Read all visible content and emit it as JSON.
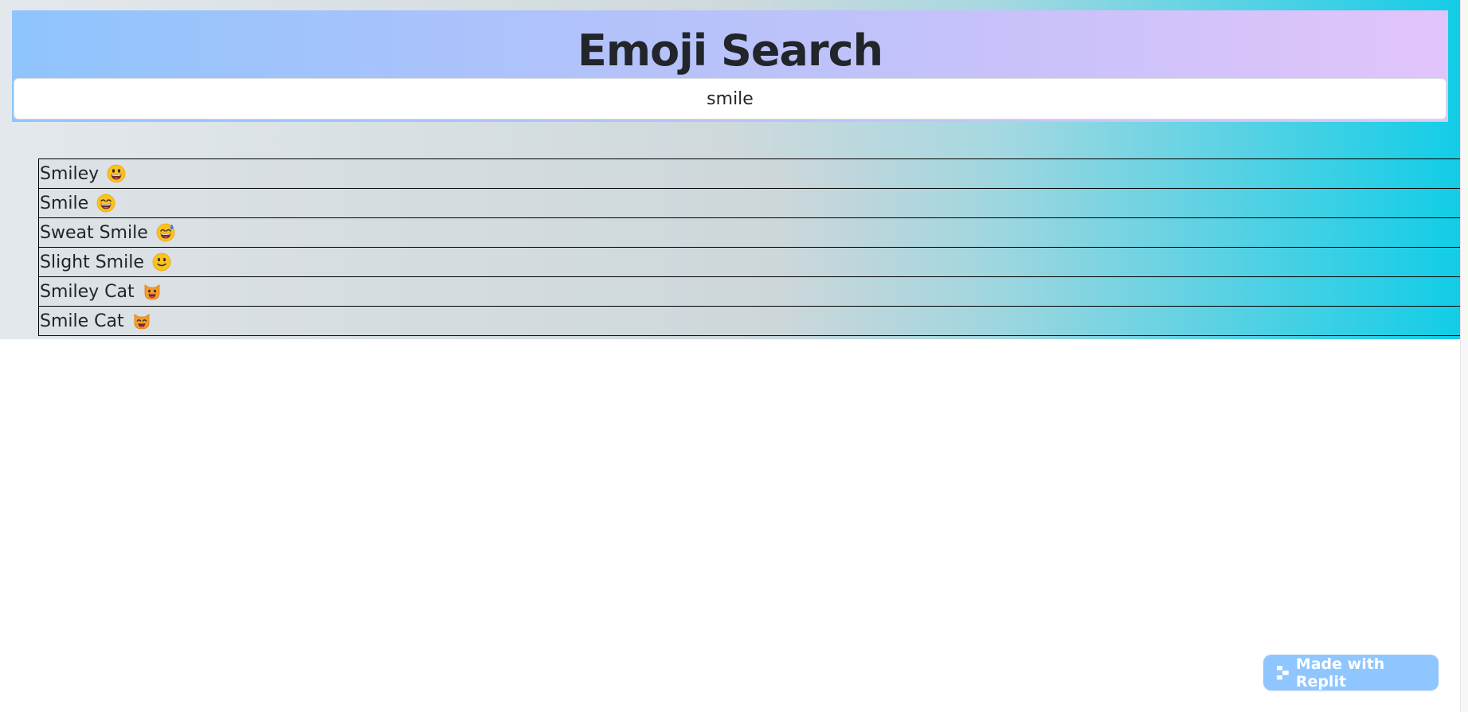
{
  "header": {
    "title": "Emoji Search"
  },
  "search": {
    "value": "smile"
  },
  "results": [
    {
      "label": "Smiley",
      "icon": "grinning-face-big-eyes-icon"
    },
    {
      "label": "Smile",
      "icon": "grinning-face-smiling-eyes-icon"
    },
    {
      "label": "Sweat Smile",
      "icon": "grinning-face-sweat-icon"
    },
    {
      "label": "Slight Smile",
      "icon": "slightly-smiling-face-icon"
    },
    {
      "label": "Smiley Cat",
      "icon": "grinning-cat-icon"
    },
    {
      "label": "Smile Cat",
      "icon": "grinning-cat-smiling-eyes-icon"
    }
  ],
  "badge": {
    "label": "Made with Replit",
    "icon": "replit-logo-icon"
  },
  "colors": {
    "header_gradient_start": "#8fc4fd",
    "header_gradient_end": "#e1c4fb",
    "list_gradient_end": "#12cde7",
    "badge_bg": "#8fc6ff"
  }
}
